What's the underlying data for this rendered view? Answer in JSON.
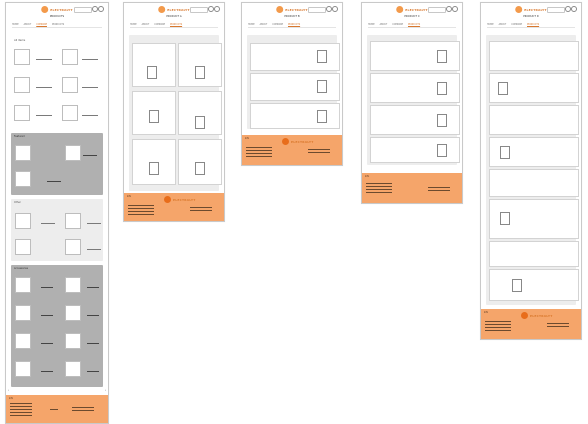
{
  "brand": {
    "name": "ELECTRALYT",
    "accent": "#f39a4b",
    "footer_color": "#f5a56a",
    "gray_section": "#b0b0b0",
    "light_section": "#ededed"
  },
  "pages": [
    {
      "title": "PRODUCTS",
      "nav": [
        "HOME",
        "ABOUT",
        "COMPARE",
        "PRODUCTS"
      ],
      "sections": [
        "All items",
        "Featured",
        "Other",
        "Accessories"
      ]
    },
    {
      "title": "PRODUCT A",
      "nav": [
        "HOME",
        "ABOUT",
        "COMPARE",
        "PRODUCTS"
      ]
    },
    {
      "title": "PRODUCT B",
      "nav": [
        "HOME",
        "ABOUT",
        "COMPARE",
        "PRODUCTS"
      ]
    },
    {
      "title": "PRODUCT C",
      "nav": [
        "HOME",
        "ABOUT",
        "COMPARE",
        "PRODUCTS"
      ]
    },
    {
      "title": "PRODUCT D",
      "nav": [
        "HOME",
        "ABOUT",
        "COMPARE",
        "PRODUCTS"
      ]
    }
  ],
  "footer": {
    "label": "Info",
    "brand": "ELECTRALYT"
  },
  "icons": [
    "search-icon",
    "user-icon",
    "cart-icon",
    "chevron-left-icon",
    "chevron-right-icon"
  ]
}
